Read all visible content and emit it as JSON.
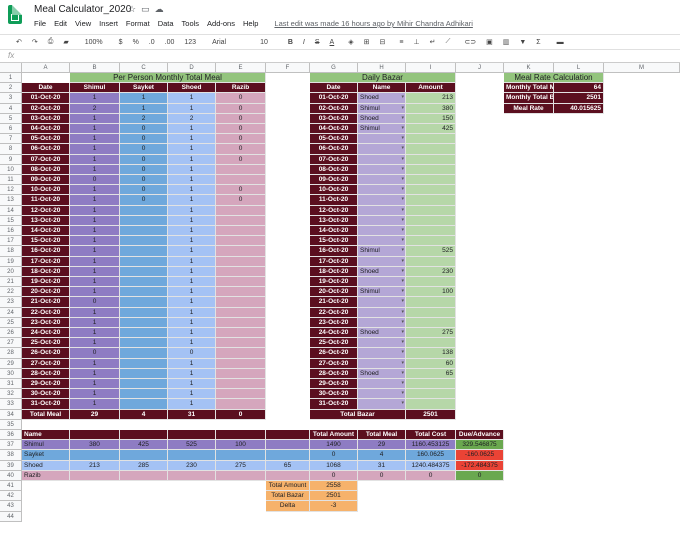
{
  "app": {
    "title": "Meal Calculator_2020",
    "last_edit": "Last edit was made 16 hours ago by Mihir Chandra Adhikari",
    "menu": [
      "File",
      "Edit",
      "View",
      "Insert",
      "Format",
      "Data",
      "Tools",
      "Add-ons",
      "Help"
    ]
  },
  "toolbar": {
    "zoom": "100%",
    "currency": "$",
    "percent": "%",
    "dec_dec": ".0",
    "dec_inc": ".00",
    "format": "123",
    "font": "Arial",
    "font_size": "10"
  },
  "fx_label": "fx",
  "columns": [
    "A",
    "B",
    "C",
    "D",
    "E",
    "F",
    "G",
    "H",
    "I",
    "J",
    "K",
    "L",
    "M"
  ],
  "colors": {
    "header_dark": "#5b0f1f",
    "title_green": "#93c47d",
    "date_col": "#8e7cc3",
    "shimul": "#8e7cc3",
    "sayket": "#6fa8dc",
    "shoed": "#a4c2f4",
    "razib": "#d5a6bd",
    "bazar_name": "#b4a7d6",
    "bazar_amt": "#b6d7a8",
    "orange": "#f6b26b",
    "red": "#ea4335",
    "green": "#6aa84f"
  },
  "meal_table": {
    "title": "Per Person Monthly Total Meal",
    "headers": [
      "Date",
      "Shimul",
      "Sayket",
      "Shoed",
      "Razib"
    ],
    "rows": [
      [
        "01-Oct-20",
        "1",
        "1",
        "1",
        "0"
      ],
      [
        "02-Oct-20",
        "2",
        "1",
        "1",
        "0"
      ],
      [
        "03-Oct-20",
        "1",
        "2",
        "2",
        "0"
      ],
      [
        "04-Oct-20",
        "1",
        "0",
        "1",
        "0"
      ],
      [
        "05-Oct-20",
        "1",
        "0",
        "1",
        "0"
      ],
      [
        "06-Oct-20",
        "1",
        "0",
        "1",
        "0"
      ],
      [
        "07-Oct-20",
        "1",
        "0",
        "1",
        "0"
      ],
      [
        "08-Oct-20",
        "1",
        "0",
        "1",
        ""
      ],
      [
        "09-Oct-20",
        "0",
        "0",
        "1",
        ""
      ],
      [
        "10-Oct-20",
        "1",
        "0",
        "1",
        "0"
      ],
      [
        "11-Oct-20",
        "1",
        "0",
        "1",
        "0"
      ],
      [
        "12-Oct-20",
        "1",
        "",
        "1",
        ""
      ],
      [
        "13-Oct-20",
        "1",
        "",
        "1",
        ""
      ],
      [
        "14-Oct-20",
        "1",
        "",
        "1",
        ""
      ],
      [
        "15-Oct-20",
        "1",
        "",
        "1",
        ""
      ],
      [
        "16-Oct-20",
        "1",
        "",
        "1",
        ""
      ],
      [
        "17-Oct-20",
        "1",
        "",
        "1",
        ""
      ],
      [
        "18-Oct-20",
        "1",
        "",
        "1",
        ""
      ],
      [
        "19-Oct-20",
        "1",
        "",
        "1",
        ""
      ],
      [
        "20-Oct-20",
        "1",
        "",
        "1",
        ""
      ],
      [
        "21-Oct-20",
        "0",
        "",
        "1",
        ""
      ],
      [
        "22-Oct-20",
        "1",
        "",
        "1",
        ""
      ],
      [
        "23-Oct-20",
        "1",
        "",
        "1",
        ""
      ],
      [
        "24-Oct-20",
        "1",
        "",
        "1",
        ""
      ],
      [
        "25-Oct-20",
        "1",
        "",
        "1",
        ""
      ],
      [
        "26-Oct-20",
        "0",
        "",
        "0",
        ""
      ],
      [
        "27-Oct-20",
        "1",
        "",
        "1",
        ""
      ],
      [
        "28-Oct-20",
        "1",
        "",
        "1",
        ""
      ],
      [
        "29-Oct-20",
        "1",
        "",
        "1",
        ""
      ],
      [
        "30-Oct-20",
        "1",
        "",
        "1",
        ""
      ],
      [
        "31-Oct-20",
        "1",
        "",
        "1",
        ""
      ]
    ],
    "total": [
      "Total Meal",
      "29",
      "4",
      "31",
      "0"
    ]
  },
  "bazar_table": {
    "title": "Daily Bazar",
    "headers": [
      "Date",
      "Name",
      "Amount"
    ],
    "rows": [
      [
        "01-Oct-20",
        "Shoed",
        "213"
      ],
      [
        "02-Oct-20",
        "Shimul",
        "380"
      ],
      [
        "03-Oct-20",
        "Shoed",
        "150"
      ],
      [
        "04-Oct-20",
        "Shimul",
        "425"
      ],
      [
        "05-Oct-20",
        "",
        ""
      ],
      [
        "06-Oct-20",
        "",
        ""
      ],
      [
        "07-Oct-20",
        "",
        ""
      ],
      [
        "08-Oct-20",
        "",
        ""
      ],
      [
        "09-Oct-20",
        "",
        ""
      ],
      [
        "10-Oct-20",
        "",
        ""
      ],
      [
        "11-Oct-20",
        "",
        ""
      ],
      [
        "12-Oct-20",
        "",
        ""
      ],
      [
        "13-Oct-20",
        "",
        ""
      ],
      [
        "14-Oct-20",
        "",
        ""
      ],
      [
        "15-Oct-20",
        "",
        ""
      ],
      [
        "16-Oct-20",
        "Shimul",
        "525"
      ],
      [
        "17-Oct-20",
        "",
        ""
      ],
      [
        "18-Oct-20",
        "Shoed",
        "230"
      ],
      [
        "19-Oct-20",
        "",
        ""
      ],
      [
        "20-Oct-20",
        "Shimul",
        "100"
      ],
      [
        "21-Oct-20",
        "",
        ""
      ],
      [
        "22-Oct-20",
        "",
        ""
      ],
      [
        "23-Oct-20",
        "",
        ""
      ],
      [
        "24-Oct-20",
        "Shoed",
        "275"
      ],
      [
        "25-Oct-20",
        "",
        ""
      ],
      [
        "26-Oct-20",
        "",
        "138"
      ],
      [
        "27-Oct-20",
        "",
        "60"
      ],
      [
        "28-Oct-20",
        "Shoed",
        "65"
      ],
      [
        "29-Oct-20",
        "",
        ""
      ],
      [
        "30-Oct-20",
        "",
        ""
      ],
      [
        "31-Oct-20",
        "",
        ""
      ]
    ],
    "total": [
      "Total Bazar",
      "2501"
    ]
  },
  "rate_table": {
    "title": "Meal Rate Calculation",
    "rows": [
      [
        "Monthly Total Meal",
        "64"
      ],
      [
        "Monthly Total Bazar",
        "2501"
      ],
      [
        "Meal Rate",
        "40.015625"
      ]
    ]
  },
  "summary": {
    "headers": [
      "Name",
      "",
      "",
      "",
      "",
      "",
      "Total Amount",
      "Total Meal",
      "Total Cost",
      "Due/Advance"
    ],
    "rows": [
      [
        "Shimul",
        "380",
        "425",
        "525",
        "100",
        "",
        "1490",
        "29",
        "1160.453125",
        "329.546875"
      ],
      [
        "Sayket",
        "",
        "",
        "",
        "",
        "",
        "0",
        "4",
        "160.0625",
        "-160.0625"
      ],
      [
        "Shoed",
        "213",
        "285",
        "230",
        "275",
        "65",
        "1068",
        "31",
        "1240.484375",
        "-172.484375"
      ],
      [
        "Razib",
        "",
        "",
        "",
        "",
        "",
        "0",
        "0",
        "0",
        "0"
      ]
    ]
  },
  "check": {
    "rows": [
      [
        "Total Amount",
        "2558"
      ],
      [
        "Total Bazar",
        "2501"
      ],
      [
        "Delta",
        "-3"
      ]
    ]
  },
  "row_numbers": [
    "1",
    "2",
    "3",
    "4",
    "5",
    "6",
    "7",
    "8",
    "9",
    "10",
    "11",
    "12",
    "13",
    "14",
    "15",
    "16",
    "17",
    "18",
    "19",
    "20",
    "21",
    "22",
    "23",
    "24",
    "25",
    "26",
    "27",
    "28",
    "29",
    "30",
    "31",
    "32",
    "33",
    "34",
    "35",
    "36",
    "37",
    "38",
    "39",
    "40",
    "41",
    "42",
    "43",
    "44"
  ]
}
